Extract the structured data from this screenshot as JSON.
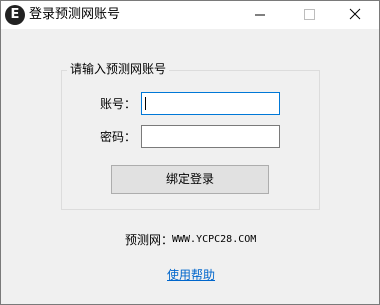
{
  "window": {
    "title": "登录预测网账号",
    "icon_glyph": "E",
    "icon": "app-logo-icon"
  },
  "controls": {
    "minimize_icon": "minimize-icon",
    "maximize_icon": "maximize-icon",
    "close_icon": "close-icon"
  },
  "form": {
    "group_title": "请输入预测网账号",
    "account_label": "账号：",
    "account_value": "",
    "password_label": "密码：",
    "password_value": "",
    "submit_label": "绑定登录"
  },
  "footer": {
    "site_label": "预测网：",
    "site_url": "WWW.YCPC28.COM",
    "help_link": "使用帮助"
  },
  "colors": {
    "link": "#0066cc",
    "focus_border": "#0078d7"
  }
}
